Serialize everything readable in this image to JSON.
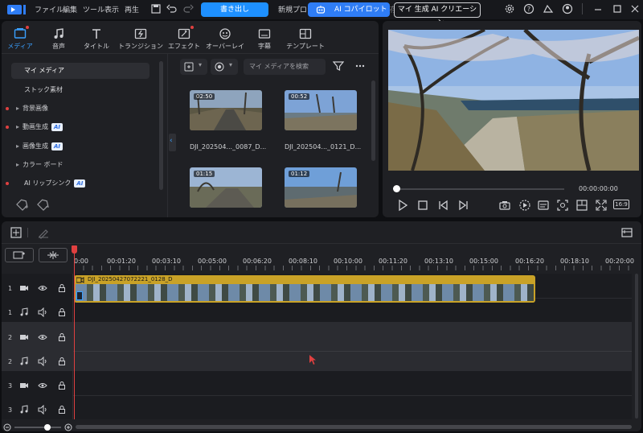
{
  "menu": {
    "items": [
      "ファイル",
      "編集",
      "ツール",
      "表示",
      "再生"
    ],
    "export_label": "書き出し",
    "project_title": "新規プロジ",
    "ai_copilot_label": "AI コパイロット",
    "ai_creation_label": "マイ 生成 AI クリエーション",
    "partial_text": "保存"
  },
  "tabs": [
    "メディア",
    "音声",
    "タイトル",
    "トランジション",
    "エフェクト",
    "オーバーレイ",
    "字幕",
    "テンプレート"
  ],
  "sidebar": {
    "items": [
      {
        "label": "マイ メディア"
      },
      {
        "label": "ストック素材"
      },
      {
        "label": "背景画像"
      },
      {
        "label": "動画生成",
        "badge": "AI"
      },
      {
        "label": "画像生成",
        "badge": "AI"
      },
      {
        "label": "カラー ボード"
      },
      {
        "label": "AI リップシンク",
        "badge": "AI"
      }
    ]
  },
  "media": {
    "search_placeholder": "マイ メディアを検索",
    "items": [
      {
        "duration": "02:50",
        "name": "DJI_202504..._0087_D..."
      },
      {
        "duration": "00:52",
        "name": "DJI_202504..._0121_D..."
      },
      {
        "duration": "01:15",
        "name": ""
      },
      {
        "duration": "01:12",
        "name": ""
      }
    ]
  },
  "preview": {
    "timecode": "00:00:00:00",
    "aspect_ratio": "16:9"
  },
  "timeline": {
    "ruler": [
      "0:00",
      "00:01:20",
      "00:03:10",
      "00:05:00",
      "00:06:20",
      "00:08:10",
      "00:10:00",
      "00:11:20",
      "00:13:10",
      "00:15:00",
      "00:16:20",
      "00:18:10",
      "00:20:00"
    ],
    "clip_name": "DJI_20250427072221_0128_D",
    "tracks": [
      "1",
      "1",
      "2",
      "2",
      "3",
      "3"
    ]
  },
  "colors": {
    "accent": "#1e90ff",
    "clip_border": "#c9a227",
    "ai_badge": "#2f6fe0"
  }
}
